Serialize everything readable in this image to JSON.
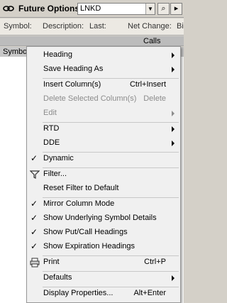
{
  "window": {
    "title": "Future Options",
    "symbol_value": "LNKD",
    "dropdown_glyph": "▼",
    "search_glyph": "⌕",
    "menu_glyph": "▸"
  },
  "info_row": {
    "symbol": "Symbol:",
    "description": "Description:",
    "last": "Last:",
    "net_change": "Net Change:",
    "bid_partial": "Bi"
  },
  "grid": {
    "group_header": "Calls",
    "symbol_col": "Symbol"
  },
  "menu": {
    "heading": "Heading",
    "save_heading_as": "Save Heading As",
    "insert_columns": "Insert Column(s)",
    "insert_columns_sc": "Ctrl+Insert",
    "delete_columns": "Delete Selected Column(s)",
    "delete_columns_sc": "Delete",
    "edit": "Edit",
    "rtd": "RTD",
    "dde": "DDE",
    "dynamic": "Dynamic",
    "filter": "Filter...",
    "reset_filter": "Reset Filter to Default",
    "mirror_column": "Mirror Column Mode",
    "show_underlying": "Show Underlying Symbol Details",
    "show_putcall": "Show Put/Call Headings",
    "show_expiration": "Show Expiration Headings",
    "print": "Print",
    "print_sc": "Ctrl+P",
    "defaults": "Defaults",
    "display_properties": "Display Properties...",
    "display_properties_sc": "Alt+Enter",
    "check_glyph": "✓"
  }
}
